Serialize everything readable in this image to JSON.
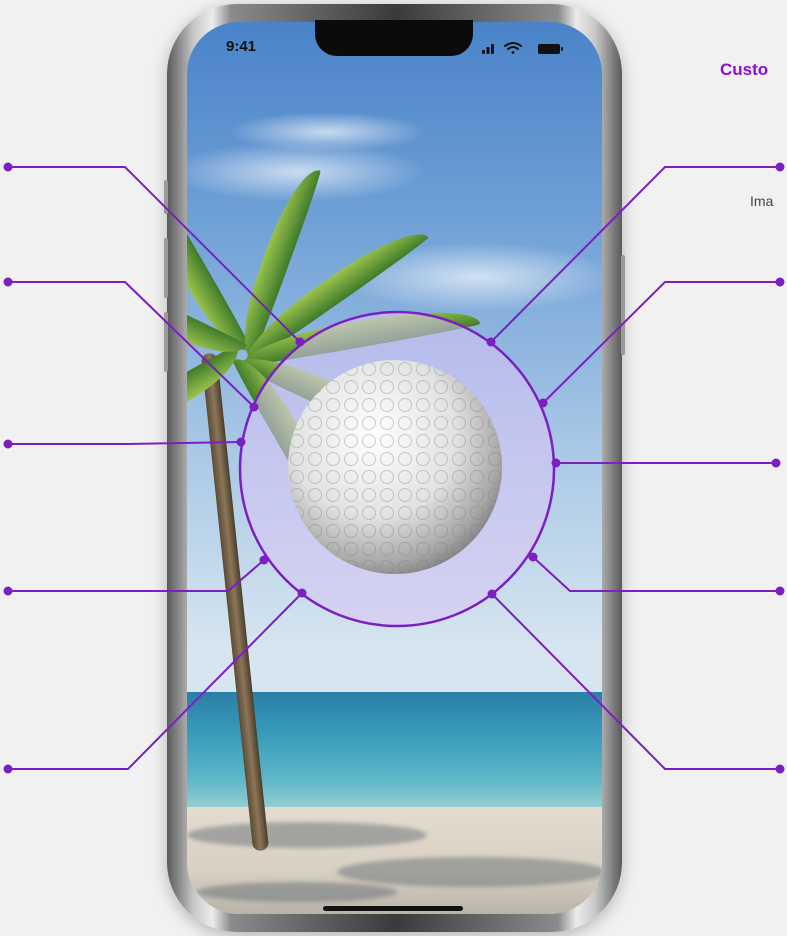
{
  "status_bar": {
    "time": "9:41"
  },
  "side_panel": {
    "title": "Custo",
    "caption": "Ima"
  },
  "colors": {
    "accent": "#7b1fc2",
    "title": "#8b10d6",
    "ring_fill": "#d8c4f5"
  },
  "icons": {
    "signal": "cellular-signal-icon",
    "wifi": "wifi-icon",
    "battery": "battery-icon"
  }
}
